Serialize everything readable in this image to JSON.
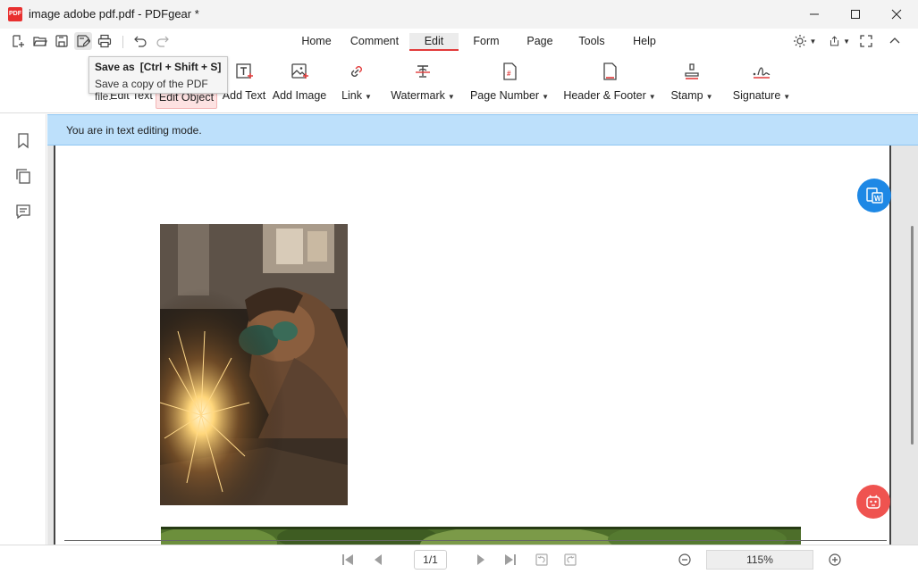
{
  "window": {
    "title": "image adobe pdf.pdf - PDFgear *",
    "logo_text": "PDF",
    "controls": [
      "minimize-icon",
      "maximize-icon",
      "close-icon"
    ]
  },
  "quick_access": [
    "new-file-icon",
    "open-folder-icon",
    "save-icon",
    "save-as-icon",
    "print-icon",
    "undo-icon",
    "redo-icon"
  ],
  "tabs": [
    {
      "label": "Home"
    },
    {
      "label": "Comment"
    },
    {
      "label": "Edit",
      "active": true
    },
    {
      "label": "Form"
    },
    {
      "label": "Page"
    },
    {
      "label": "Tools"
    },
    {
      "label": "Help"
    }
  ],
  "tools": {
    "edit_text": "Edit Text",
    "edit_object": "Edit Object",
    "add_text": "Add Text",
    "add_image": "Add Image",
    "link": "Link",
    "watermark": "Watermark",
    "page_number": "Page Number",
    "header_footer": "Header & Footer",
    "stamp": "Stamp",
    "signature": "Signature"
  },
  "tooltip": {
    "title": "Save as",
    "shortcut": "[Ctrl + Shift + S]",
    "description": "Save a copy of the PDF file."
  },
  "banner": {
    "text": "You are in text editing mode.",
    "color": "#bde0fb"
  },
  "navigation": {
    "page_indicator": "1/1",
    "zoom": "115%"
  },
  "colors": {
    "accent": "#e23b3b",
    "convert_button": "#1e88e5",
    "assistant_button": "#ef5350"
  }
}
